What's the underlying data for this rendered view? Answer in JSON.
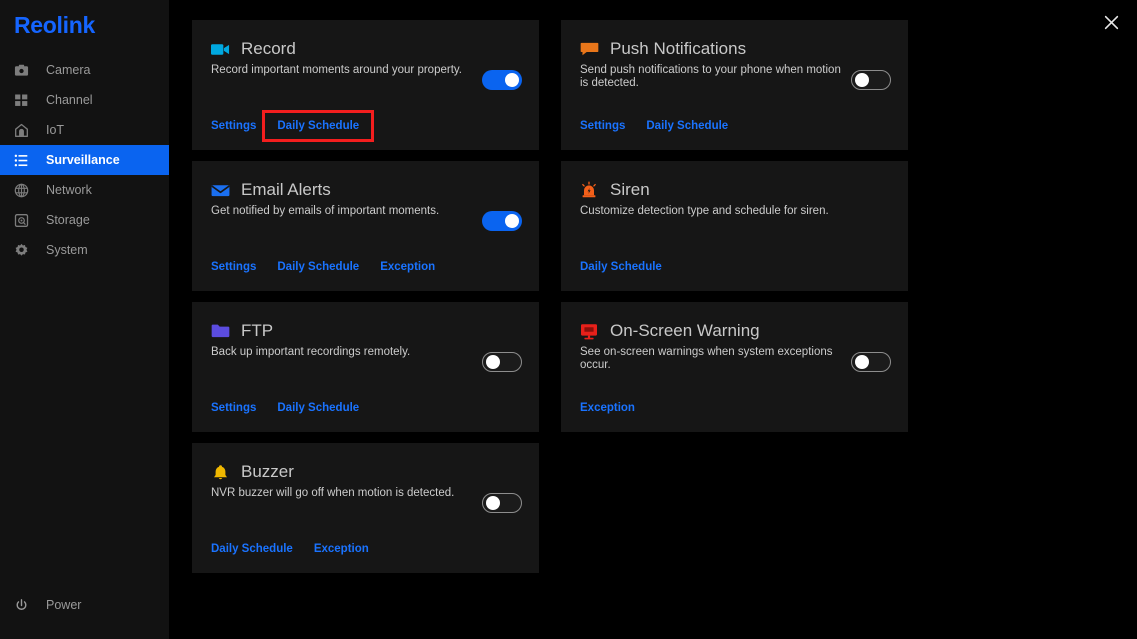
{
  "app": {
    "brand": "Reolink",
    "close_label": "✕"
  },
  "sidebar": {
    "items": [
      {
        "label": "Camera",
        "icon": "camera-icon",
        "active": false
      },
      {
        "label": "Channel",
        "icon": "channel-grid-icon",
        "active": false
      },
      {
        "label": "IoT",
        "icon": "iot-home-icon",
        "active": false
      },
      {
        "label": "Surveillance",
        "icon": "list-icon",
        "active": true
      },
      {
        "label": "Network",
        "icon": "globe-icon",
        "active": false
      },
      {
        "label": "Storage",
        "icon": "harddisk-icon",
        "active": false
      },
      {
        "label": "System",
        "icon": "gear-icon",
        "active": false
      }
    ],
    "power": {
      "label": "Power",
      "icon": "power-icon"
    }
  },
  "colors": {
    "accent_blue": "#0a64f0",
    "link_blue": "#1a73ff",
    "highlight_red": "#f41e1e",
    "card_bg": "#161616",
    "page_bg": "#000000",
    "sidebar_bg": "#121212",
    "icon_record_cyan": "#00a8e0",
    "icon_push_orange": "#e8761a",
    "icon_email_blue": "#1a6ff0",
    "icon_siren_orange": "#f4601a",
    "icon_ftp_purple": "#5b4ce0",
    "icon_warning_red": "#e8201a",
    "icon_buzzer_yellow": "#f0b800"
  },
  "cards": [
    {
      "id": "record",
      "title": "Record",
      "icon": "video-camera-icon",
      "icon_color": "#00a8e0",
      "description": "Record important moments around your property.",
      "toggle": {
        "present": true,
        "state": "on"
      },
      "links": [
        {
          "label": "Settings",
          "highlighted": false
        },
        {
          "label": "Daily Schedule",
          "highlighted": true
        }
      ]
    },
    {
      "id": "push-notifications",
      "title": "Push Notifications",
      "icon": "speech-bubble-icon",
      "icon_color": "#e8761a",
      "description": "Send push notifications to your phone when motion is detected.",
      "toggle": {
        "present": true,
        "state": "off"
      },
      "links": [
        {
          "label": "Settings",
          "highlighted": false
        },
        {
          "label": "Daily Schedule",
          "highlighted": false
        }
      ]
    },
    {
      "id": "email-alerts",
      "title": "Email Alerts",
      "icon": "envelope-icon",
      "icon_color": "#1a6ff0",
      "description": "Get notified by emails of important moments.",
      "toggle": {
        "present": true,
        "state": "on"
      },
      "links": [
        {
          "label": "Settings",
          "highlighted": false
        },
        {
          "label": "Daily Schedule",
          "highlighted": false
        },
        {
          "label": "Exception",
          "highlighted": false
        }
      ]
    },
    {
      "id": "siren",
      "title": "Siren",
      "icon": "siren-icon",
      "icon_color": "#f4601a",
      "description": "Customize detection type and schedule for siren.",
      "toggle": {
        "present": false,
        "state": "none"
      },
      "links": [
        {
          "label": "Daily Schedule",
          "highlighted": false
        }
      ]
    },
    {
      "id": "ftp",
      "title": "FTP",
      "icon": "folder-icon",
      "icon_color": "#5b4ce0",
      "description": "Back up important recordings remotely.",
      "toggle": {
        "present": true,
        "state": "off"
      },
      "links": [
        {
          "label": "Settings",
          "highlighted": false
        },
        {
          "label": "Daily Schedule",
          "highlighted": false
        }
      ]
    },
    {
      "id": "on-screen-warning",
      "title": "On-Screen Warning",
      "icon": "monitor-warning-icon",
      "icon_color": "#e8201a",
      "description": "See on-screen warnings when system exceptions occur.",
      "toggle": {
        "present": true,
        "state": "off"
      },
      "links": [
        {
          "label": "Exception",
          "highlighted": false
        }
      ]
    },
    {
      "id": "buzzer",
      "title": "Buzzer",
      "icon": "bell-icon",
      "icon_color": "#f0b800",
      "description": "NVR buzzer will go off when motion is detected.",
      "toggle": {
        "present": true,
        "state": "off"
      },
      "links": [
        {
          "label": "Daily Schedule",
          "highlighted": false
        },
        {
          "label": "Exception",
          "highlighted": false
        }
      ]
    }
  ]
}
